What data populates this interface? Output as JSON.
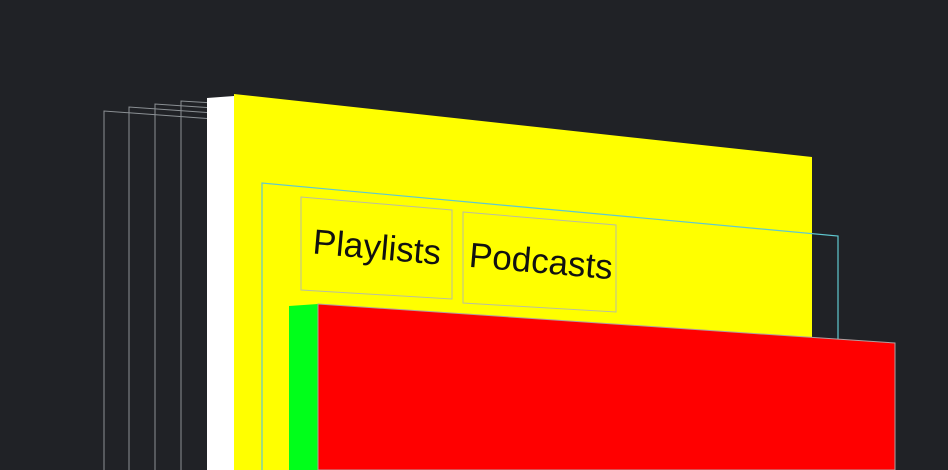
{
  "canvas": {
    "background": "#202226"
  },
  "colors": {
    "frame_outline": "#8b9094",
    "white_layer": "#ffffff",
    "yellow_panel": "#ffff00",
    "cyan_outline": "#5fc8d0",
    "tab_outline": "#b9bfa0",
    "tab_text": "#111111",
    "green_layer": "#00ff1a",
    "red_panel": "#ff0000",
    "red_panel_outline": "#b0a0a0"
  },
  "tabs": [
    {
      "label": "Playlists"
    },
    {
      "label": "Podcasts"
    }
  ]
}
